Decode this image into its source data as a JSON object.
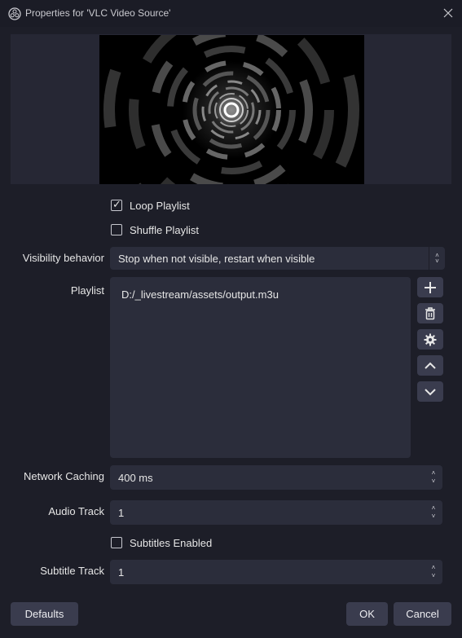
{
  "window": {
    "title": "Properties for 'VLC Video Source'"
  },
  "options": {
    "loop_playlist": {
      "label": "Loop Playlist",
      "checked": true
    },
    "shuffle_playlist": {
      "label": "Shuffle Playlist",
      "checked": false
    },
    "subtitles_enabled": {
      "label": "Subtitles Enabled",
      "checked": false
    }
  },
  "visibility": {
    "label": "Visibility behavior",
    "value": "Stop when not visible, restart when visible"
  },
  "playlist": {
    "label": "Playlist",
    "items": [
      "D:/_livestream/assets/output.m3u"
    ],
    "buttons": [
      "add-icon",
      "trash-icon",
      "gear-icon",
      "chevron-up-icon",
      "chevron-down-icon"
    ]
  },
  "network_caching": {
    "label": "Network Caching",
    "value": "400 ms"
  },
  "audio_track": {
    "label": "Audio Track",
    "value": "1"
  },
  "subtitle_track": {
    "label": "Subtitle Track",
    "value": "1"
  },
  "footer": {
    "defaults": "Defaults",
    "ok": "OK",
    "cancel": "Cancel"
  },
  "colors": {
    "background": "#1d1e28",
    "field": "#2b2d3b",
    "button": "#3a3c4e"
  }
}
